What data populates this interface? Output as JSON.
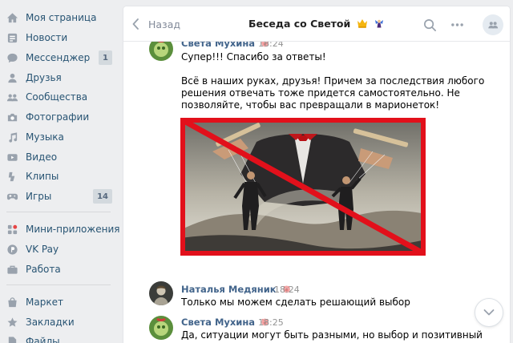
{
  "sidebar": {
    "items": [
      {
        "label": "Моя страница",
        "icon": "home-icon"
      },
      {
        "label": "Новости",
        "icon": "news-icon"
      },
      {
        "label": "Мессенджер",
        "icon": "messenger-icon",
        "badge": "1"
      },
      {
        "label": "Друзья",
        "icon": "friends-icon"
      },
      {
        "label": "Сообщества",
        "icon": "communities-icon"
      },
      {
        "label": "Фотографии",
        "icon": "camera-icon"
      },
      {
        "label": "Музыка",
        "icon": "music-icon"
      },
      {
        "label": "Видео",
        "icon": "video-icon"
      },
      {
        "label": "Клипы",
        "icon": "clips-icon"
      },
      {
        "label": "Игры",
        "icon": "games-icon",
        "badge": "14"
      },
      {
        "label": "Мини-приложения",
        "icon": "mini-apps-icon"
      },
      {
        "label": "VK Pay",
        "icon": "vkpay-icon"
      },
      {
        "label": "Работа",
        "icon": "work-icon"
      },
      {
        "label": "Маркет",
        "icon": "market-icon"
      },
      {
        "label": "Закладки",
        "icon": "bookmarks-icon"
      },
      {
        "label": "Файлы",
        "icon": "files-icon"
      }
    ]
  },
  "header": {
    "back_label": "Назад",
    "title": "Беседа со Светой",
    "title_emojis": [
      "crown-emoji",
      "fairy-emoji"
    ],
    "icons": [
      "search-icon",
      "more-icon",
      "members-icon"
    ]
  },
  "messages": [
    {
      "author": "Света Мухина",
      "author_emoji": "pig-emoji",
      "time": "18:24",
      "lines": [
        "Супер!!! Спасибо за ответы!",
        "",
        "Всё в наших руках, друзья! Причем за последствия любого",
        "решения отвечать тоже придется самостоятельно. Не",
        "позволяйте, чтобы вас превращали в марионеток!"
      ],
      "image": "puppet-master-crossed-out-image"
    },
    {
      "author": "Наталья Медяник",
      "author_emoji": "pig-emoji",
      "time": "18:24",
      "lines": [
        "Только мы можем сделать решающий выбор"
      ]
    },
    {
      "author": "Света Мухина",
      "author_emoji": "pig-emoji",
      "time": "18:25",
      "lines": [
        "Да, ситуации могут быть разными, но выбор и позитивный"
      ]
    }
  ],
  "colors": {
    "background": "#edeef0",
    "link": "#285473",
    "author": "#42648b",
    "badge_bg": "#d3d9de",
    "cross_red": "#e2101b"
  }
}
